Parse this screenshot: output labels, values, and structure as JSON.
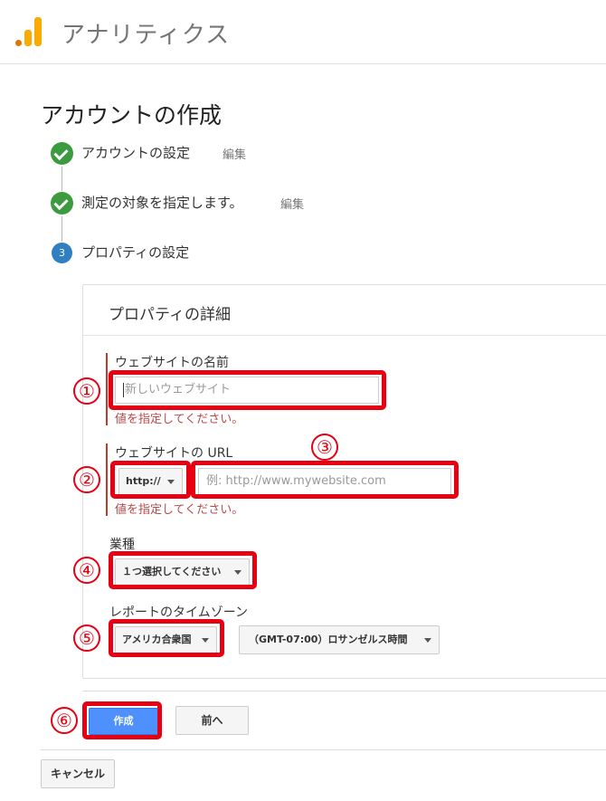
{
  "header": {
    "app_title": "アナリティクス",
    "logo_icon": "analytics-bar-chart-icon"
  },
  "page": {
    "title": "アカウントの作成"
  },
  "steps": [
    {
      "label": "アカウントの設定",
      "edit": "編集",
      "state": "done"
    },
    {
      "label": "測定の対象を指定します。",
      "edit": "編集",
      "state": "done"
    },
    {
      "label": "プロパティの設定",
      "number": "3",
      "state": "current"
    }
  ],
  "property": {
    "title": "プロパティの詳細",
    "website_name": {
      "label": "ウェブサイトの名前",
      "placeholder": "新しいウェブサイト",
      "error": "値を指定してください。"
    },
    "website_url": {
      "label": "ウェブサイトの URL",
      "protocol": "http://",
      "placeholder": "例: http://www.mywebsite.com",
      "error": "値を指定してください。"
    },
    "industry": {
      "label": "業種",
      "selected": "１つ選択してください"
    },
    "timezone": {
      "label": "レポートのタイムゾーン",
      "country": "アメリカ合衆国",
      "zone": "（GMT-07:00）ロサンゼルス時間"
    }
  },
  "actions": {
    "create": "作成",
    "back": "前へ",
    "cancel": "キャンセル"
  },
  "annotations": [
    "①",
    "②",
    "③",
    "④",
    "⑤",
    "⑥"
  ],
  "colors": {
    "highlight": "#e60012",
    "primary": "#4d90fe",
    "check": "#3c9a3f",
    "step": "#2f7fc1",
    "error": "#b94a48"
  }
}
